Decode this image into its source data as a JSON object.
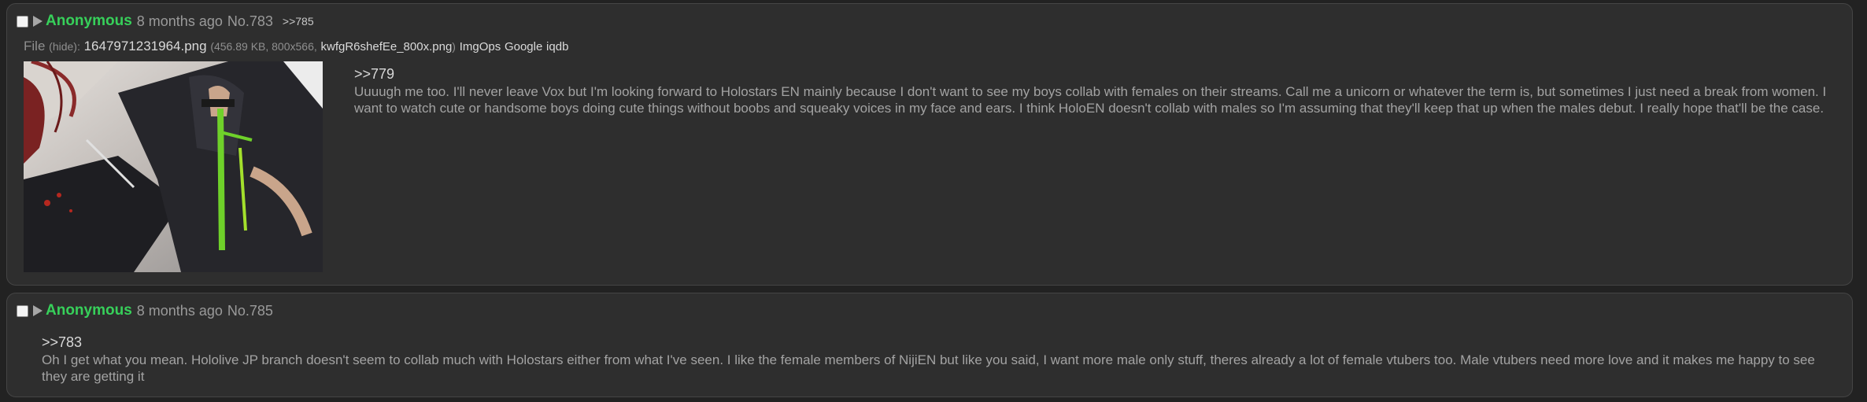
{
  "posts": [
    {
      "author": "Anonymous",
      "timestamp": "8 months ago",
      "post_no": "No.783",
      "backlink": ">>785",
      "file": {
        "label": "File",
        "hide_link": "hide",
        "filename": "1647971231964.png",
        "meta": "456.89 KB, 800x566,",
        "original_name": "kwfgR6shefEe_800x.png",
        "search_links": [
          "ImgOps",
          "Google",
          "iqdb"
        ]
      },
      "quote": ">>779",
      "message": "Uuuugh me too. I'll never leave Vox but I'm looking forward to Holostars EN mainly because I don't want to see my boys collab with females on their streams. Call me a unicorn or whatever the term is, but sometimes I just need a break from women. I want to watch cute or handsome boys doing cute things without boobs and squeaky voices in my face and ears. I think HoloEN doesn't collab with males so I'm assuming that they'll keep that up when the males debut. I really hope that'll be the case."
    },
    {
      "author": "Anonymous",
      "timestamp": "8 months ago",
      "post_no": "No.785",
      "quote": ">>783",
      "message": "Oh I get what you mean. Hololive JP branch doesn't seem to collab much with Holostars either from what I've seen. I like the female members of NijiEN but like you said, I want more male only stuff, theres already a lot of female vtubers too. Male vtubers need more love and it makes me happy to see they are getting it"
    }
  ],
  "colors": {
    "background": "#222222",
    "post_background": "#2e2e2e",
    "author": "#37d05a",
    "body_text": "#a3a3a3"
  }
}
